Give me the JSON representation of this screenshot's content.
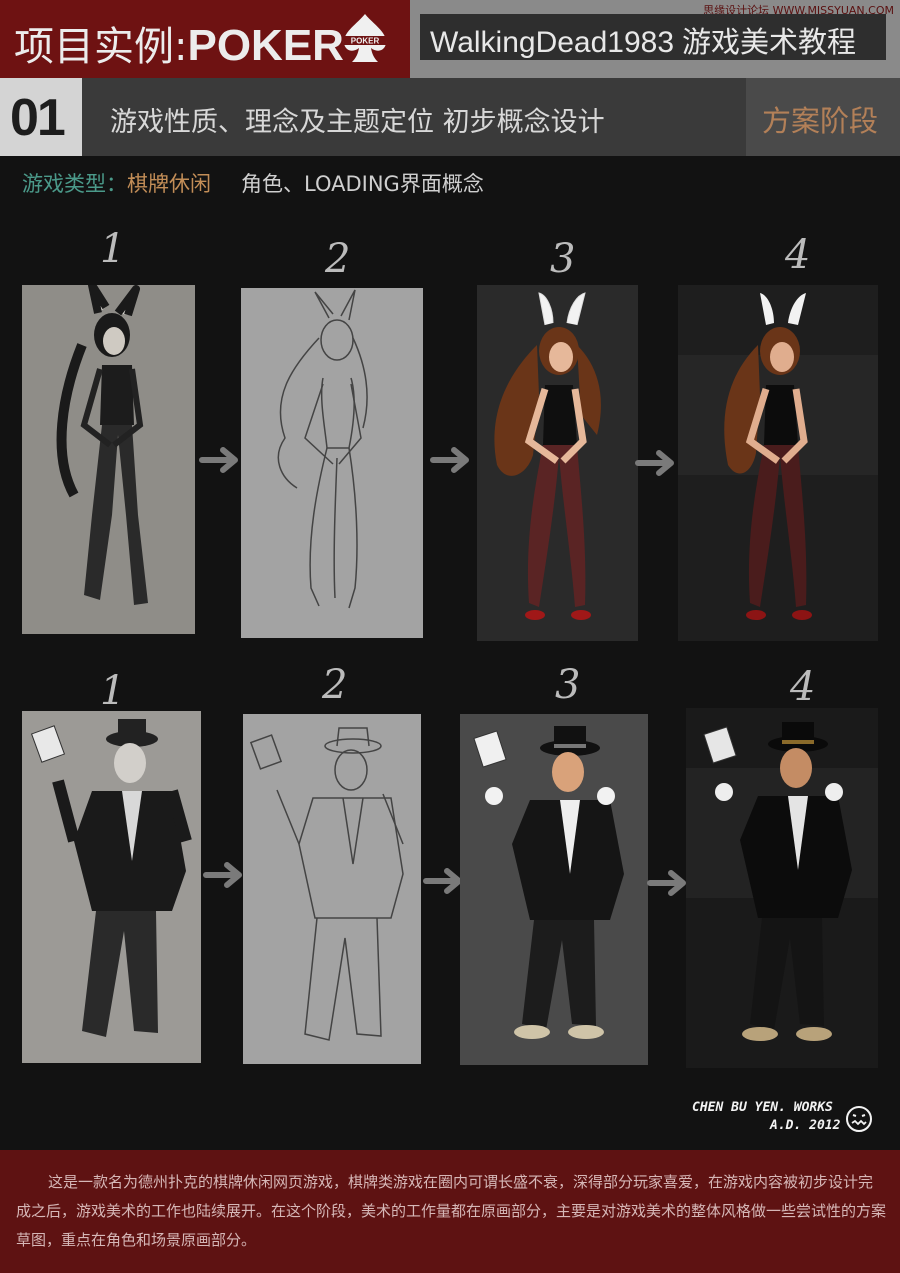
{
  "header": {
    "title_prefix": "项目实例:",
    "title_brand": "POKER",
    "logo_text": "POKER",
    "brand_name": "WalkingDead1983",
    "brand_cn": "游戏美术教程",
    "watermark": "思缘设计论坛 WWW.MISSYUAN.COM"
  },
  "stage": {
    "number": "01",
    "title": "游戏性质、理念及主题定位 初步概念设计",
    "phase": "方案阶段"
  },
  "subtitle": {
    "label": "游戏类型：",
    "value": "棋牌休闲",
    "desc": "角色、LOADING界面概念"
  },
  "rows": [
    {
      "name": "bunny-girl",
      "steps": [
        "1",
        "2",
        "3",
        "4"
      ]
    },
    {
      "name": "gambler",
      "steps": [
        "1",
        "2",
        "3",
        "4"
      ]
    }
  ],
  "signature": {
    "line1": "CHEN BU YEN. WORKS",
    "line2": "A.D. 2012"
  },
  "footer": {
    "text": "这是一款名为德州扑克的棋牌休闲网页游戏，棋牌类游戏在圈内可谓长盛不衰，深得部分玩家喜爱，在游戏内容被初步设计完成之后，游戏美术的工作也陆续展开。在这个阶段，美术的工作量都在原画部分，主要是对游戏美术的整体风格做一些尝试性的方案草图，重点在角色和场景原画部分。"
  },
  "colors": {
    "title_red": "#6e1212",
    "footer_red": "#5e1212",
    "accent_teal": "#4b9a8a",
    "accent_orange": "#c28d57"
  }
}
